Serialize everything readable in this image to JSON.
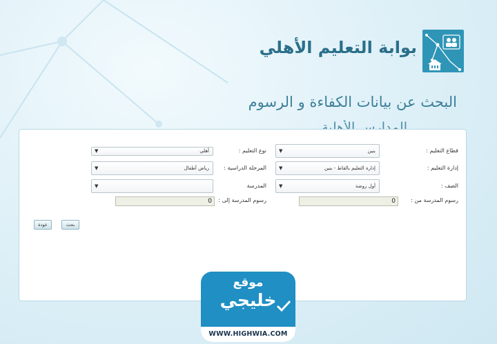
{
  "header": {
    "portal_title": "بوابة التعليم الأهلي",
    "page_title": "البحث عن بيانات الكفاءة و الرسوم",
    "page_subtitle": "المدارس الأهلية"
  },
  "form": {
    "right_column": {
      "sector_label": "قطاع التعليم :",
      "sector_value": "بنين",
      "admin_label": "إدارة التعليم :",
      "admin_value": "إدارة التعليم بالقاط - بنين",
      "grade_label": "الصف :",
      "grade_value": "أول روضة",
      "fees_from_label": "رسوم المدرسة من :",
      "fees_from_value": "0"
    },
    "left_column": {
      "type_label": "نوع التعليم :",
      "type_value": "أهلي",
      "stage_label": "المرحلة الدراسية :",
      "stage_value": "رياض أطفال",
      "school_label": "المدرسة",
      "school_value": "",
      "fees_to_label": "رسوم المدرسة إلى :",
      "fees_to_value": "0"
    },
    "search_button": "بحث",
    "back_button": "عودة",
    "dropdown_arrow": "▼"
  },
  "watermark": {
    "line1": "موقع",
    "line2": "خليجي",
    "url": "WWW.HIGHWIA.COM"
  },
  "colors": {
    "background": "#d6ecf5",
    "logo": "#2f95b6",
    "title": "#2b6f8a",
    "watermark": "#1f8fc4"
  }
}
